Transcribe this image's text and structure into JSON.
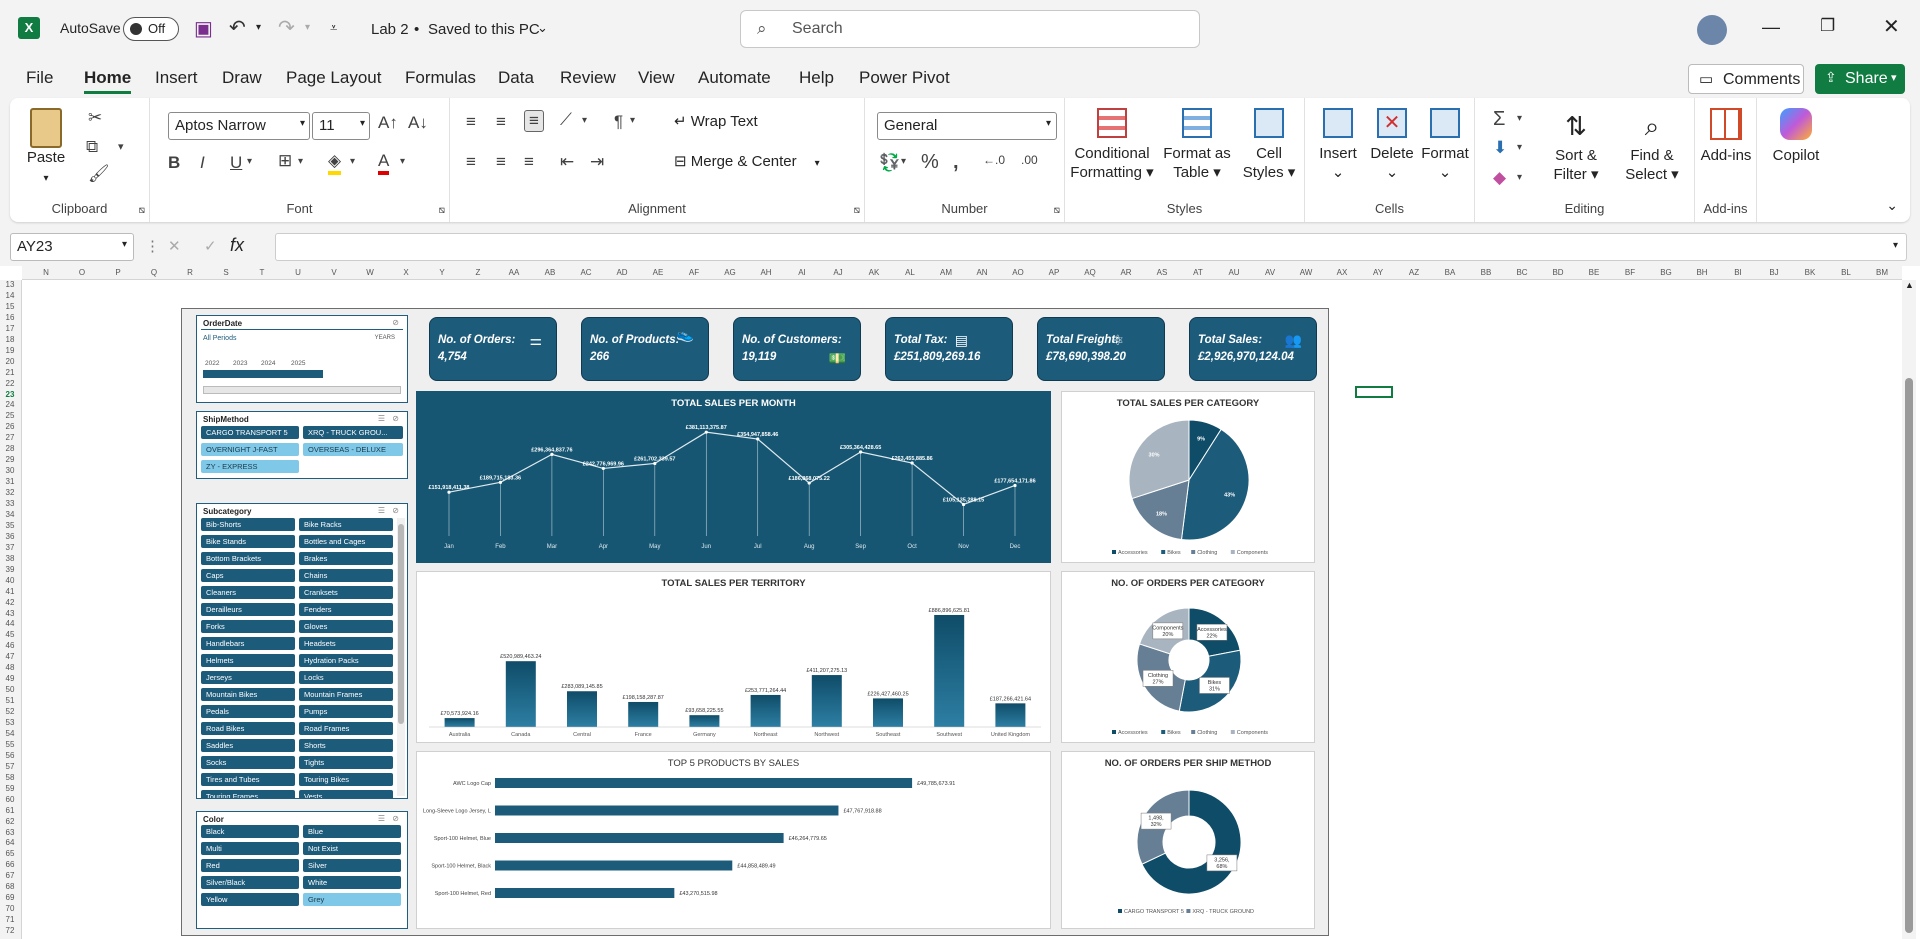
{
  "titlebar": {
    "autosave_label": "AutoSave",
    "autosave_state": "Off",
    "file_title": "Lab 2",
    "save_status": "Saved to this PC",
    "search_placeholder": "Search"
  },
  "ribbon_tabs": [
    "File",
    "Home",
    "Insert",
    "Draw",
    "Page Layout",
    "Formulas",
    "Data",
    "Review",
    "View",
    "Automate",
    "Help",
    "Power Pivot"
  ],
  "comments_label": "Comments",
  "share_label": "Share",
  "ribbon": {
    "clipboard": {
      "label": "Clipboard",
      "paste": "Paste"
    },
    "font": {
      "label": "Font",
      "family": "Aptos Narrow",
      "size": "11"
    },
    "alignment": {
      "label": "Alignment",
      "wrap": "Wrap Text",
      "merge": "Merge & Center"
    },
    "number": {
      "label": "Number",
      "format": "General"
    },
    "styles": {
      "label": "Styles",
      "cond1": "Conditional",
      "cond2": "Formatting",
      "fmt1": "Format as",
      "fmt2": "Table",
      "cell1": "Cell",
      "cell2": "Styles"
    },
    "cells": {
      "label": "Cells",
      "insert": "Insert",
      "delete": "Delete",
      "format": "Format"
    },
    "editing": {
      "label": "Editing",
      "sort1": "Sort &",
      "sort2": "Filter",
      "find1": "Find &",
      "find2": "Select"
    },
    "addins": {
      "label": "Add-ins",
      "addins": "Add-ins",
      "copilot": "Copilot"
    }
  },
  "formula_bar": {
    "name_box": "AY23",
    "fx": "fx",
    "content": ""
  },
  "columns": [
    "N",
    "O",
    "P",
    "Q",
    "R",
    "S",
    "T",
    "U",
    "V",
    "W",
    "X",
    "Y",
    "Z",
    "AA",
    "AB",
    "AC",
    "AD",
    "AE",
    "AF",
    "AG",
    "AH",
    "AI",
    "AJ",
    "AK",
    "AL",
    "AM",
    "AN",
    "AO",
    "AP",
    "AQ",
    "AR",
    "AS",
    "AT",
    "AU",
    "AV",
    "AW",
    "AX",
    "AY",
    "AZ",
    "BA",
    "BB",
    "BC",
    "BD",
    "BE",
    "BF",
    "BG",
    "BH",
    "BI",
    "BJ",
    "BK",
    "BL",
    "BM"
  ],
  "rows": [
    "13",
    "14",
    "15",
    "16",
    "17",
    "18",
    "19",
    "20",
    "21",
    "22",
    "23",
    "24",
    "25",
    "26",
    "27",
    "28",
    "29",
    "30",
    "31",
    "32",
    "33",
    "34",
    "35",
    "36",
    "37",
    "38",
    "39",
    "40",
    "41",
    "42",
    "43",
    "44",
    "45",
    "46",
    "47",
    "48",
    "49",
    "50",
    "51",
    "52",
    "53",
    "54",
    "55",
    "56",
    "57",
    "58",
    "59",
    "60",
    "61",
    "62",
    "63",
    "64",
    "65",
    "66",
    "67",
    "68",
    "69",
    "70",
    "71",
    "72"
  ],
  "slicers": {
    "orderdate": {
      "title": "OrderDate",
      "period": "All Periods",
      "unit": "YEARS",
      "years": [
        "2022",
        "2023",
        "2024",
        "2025"
      ]
    },
    "shipmethod": {
      "title": "ShipMethod",
      "items": [
        "CARGO TRANSPORT 5",
        "XRQ - TRUCK GROU...",
        "OVERNIGHT J-FAST",
        "OVERSEAS - DELUXE",
        "ZY - EXPRESS"
      ]
    },
    "subcategory": {
      "title": "Subcategory",
      "items": [
        "Bib-Shorts",
        "Bike Racks",
        "Bike Stands",
        "Bottles and Cages",
        "Bottom Brackets",
        "Brakes",
        "Caps",
        "Chains",
        "Cleaners",
        "Cranksets",
        "Derailleurs",
        "Fenders",
        "Forks",
        "Gloves",
        "Handlebars",
        "Headsets",
        "Helmets",
        "Hydration Packs",
        "Jerseys",
        "Locks",
        "Mountain Bikes",
        "Mountain Frames",
        "Pedals",
        "Pumps",
        "Road Bikes",
        "Road Frames",
        "Saddles",
        "Shorts",
        "Socks",
        "Tights",
        "Tires and Tubes",
        "Touring Bikes",
        "Touring Frames",
        "Vests"
      ]
    },
    "color": {
      "title": "Color",
      "items": [
        "Black",
        "Blue",
        "Multi",
        "Not Exist",
        "Red",
        "Silver",
        "Silver/Black",
        "White",
        "Yellow",
        "Grey"
      ]
    }
  },
  "kpis": [
    {
      "label": "No. of Orders:",
      "value": "4,754"
    },
    {
      "label": "No. of Products:",
      "value": "266"
    },
    {
      "label": "No. of Customers:",
      "value": "19,119"
    },
    {
      "label": "Total Tax:",
      "value": "£251,809,269.16"
    },
    {
      "label": "Total Freight:",
      "value": "£78,690,398.20"
    },
    {
      "label": "Total Sales:",
      "value": "£2,926,970,124.04"
    }
  ],
  "chart_data": [
    {
      "type": "line",
      "title": "TOTAL SALES PER MONTH",
      "categories": [
        "Jan",
        "Feb",
        "Mar",
        "Apr",
        "May",
        "Jun",
        "Jul",
        "Aug",
        "Sep",
        "Oct",
        "Nov",
        "Dec"
      ],
      "values": [
        151918411.38,
        189715183.36,
        296364837.76,
        242776969.96,
        261702339.57,
        381113375.87,
        354947858.46,
        186868075.22,
        305364428.65,
        263455885.86,
        105135288.15,
        177654171.86
      ],
      "labels": [
        "£151,918,411.38",
        "£189,715,183.36",
        "£296,364,837.76",
        "£242,776,969.96",
        "£261,702,339.57",
        "£381,113,375.87",
        "£354,947,858.46",
        "£186,868,075.22",
        "£305,364,428.65",
        "£263,455,885.86",
        "£105,135,288.15",
        "£177,654,171.86"
      ]
    },
    {
      "type": "bar",
      "title": "TOTAL SALES PER TERRITORY",
      "categories": [
        "Australia",
        "Canada",
        "Central",
        "France",
        "Germany",
        "Northeast",
        "Northwest",
        "Southeast",
        "Southwest",
        "United Kingdom"
      ],
      "values": [
        70573924.16,
        520989463.24,
        283089145.85,
        198158287.87,
        93658225.55,
        253771264.44,
        411207275.13,
        226427460.25,
        886896625.81,
        187266421.64
      ],
      "labels": [
        "£70,573,924.16",
        "£520,989,463.24",
        "£283,089,145.85",
        "£198,158,287.87",
        "£93,658,225.55",
        "£253,771,264.44",
        "£411,207,275.13",
        "£226,427,460.25",
        "£886,896,625.81",
        "£187,266,421.64"
      ]
    },
    {
      "type": "bar",
      "title": "TOP 5 PRODUCTS BY SALES",
      "categories": [
        "AWC Logo Cap",
        "Long-Sleeve Logo Jersey, L",
        "Sport-100 Helmet, Blue",
        "Sport-100 Helmet, Black",
        "Sport-100 Helmet, Red"
      ],
      "values": [
        49785673.91,
        47767918.88,
        46264779.65,
        44858489.49,
        43270515.98
      ],
      "labels": [
        "£49,785,673.91",
        "£47,767,918.88",
        "£46,264,779.65",
        "£44,858,489.49",
        "£43,270,515.98"
      ]
    },
    {
      "type": "pie",
      "title": "TOTAL SALES PER CATEGORY",
      "categories": [
        "Accessories",
        "Bikes",
        "Clothing",
        "Components"
      ],
      "values": [
        9,
        43,
        18,
        30
      ],
      "labels": [
        "9%",
        "43%",
        "18%",
        "30%"
      ]
    },
    {
      "type": "pie",
      "title": "NO. OF ORDERS PER CATEGORY",
      "categories": [
        "Accessories",
        "Bikes",
        "Clothing",
        "Components"
      ],
      "values": [
        22,
        31,
        27,
        20
      ],
      "labels": [
        "Accessories 22%",
        "Bikes 31%",
        "Clothing 27%",
        "Components 20%"
      ]
    },
    {
      "type": "pie",
      "title": "NO. OF ORDERS PER SHIP METHOD",
      "categories": [
        "CARGO TRANSPORT 5",
        "XRQ - TRUCK GROUND"
      ],
      "values": [
        68,
        32
      ],
      "labels": [
        "3,256, 68%",
        "1,498, 32%"
      ]
    }
  ],
  "colors": {
    "navy": "#1d5b7b",
    "dark": "#0f4c68",
    "grey": "#a8b4c0",
    "slate": "#667f95",
    "light": "#7fc8e8",
    "excel_green": "#107c41"
  }
}
